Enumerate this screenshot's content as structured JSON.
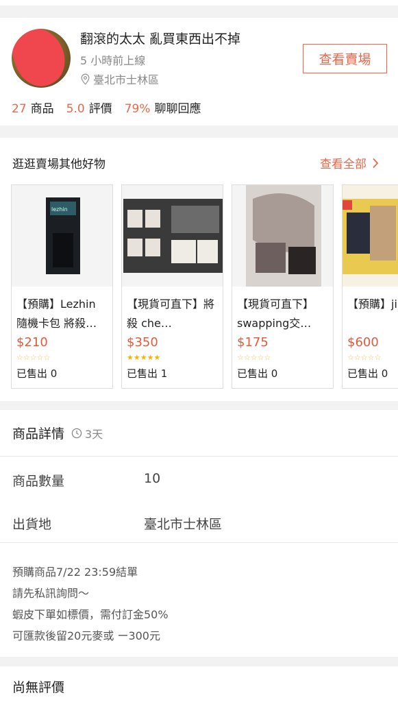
{
  "seller": {
    "name": "翻滾的太太 亂買東西出不掉",
    "status": "5 小時前上線",
    "location": "臺北市士林區",
    "view_shop": "查看賣場",
    "stats": [
      {
        "num": "27",
        "label": "商品"
      },
      {
        "num": "5.0",
        "label": "評價"
      },
      {
        "num": "79%",
        "label": "聊聊回應"
      }
    ]
  },
  "other_goods": {
    "title": "逛逛賣場其他好物",
    "view_all": "查看全部",
    "items": [
      {
        "title": "【預購】Lezhin 隨機卡包 將殺…",
        "price": "$210",
        "rating": 0,
        "sold": "已售出 0"
      },
      {
        "title": "【現貨可直下】將殺 che…",
        "price": "$350",
        "rating": 5,
        "sold": "已售出 1"
      },
      {
        "title": "【現貨可直下】swapping交…",
        "price": "$175",
        "rating": 0,
        "sold": "已售出 0"
      },
      {
        "title": "【預購】jinx 日版",
        "price": "$600",
        "rating": 0,
        "sold": "已售出 0"
      }
    ]
  },
  "details": {
    "heading": "商品詳情",
    "time": "3天",
    "quantity_label": "商品數量",
    "quantity_value": "10",
    "ship_label": "出貨地",
    "ship_value": "臺北市士林區",
    "description": [
      "預購商品7/22 23:59結單",
      "請先私訊詢問～",
      "蝦皮下單如標價，需付訂金50%",
      "可匯款後留20元麥或 ー300元"
    ]
  },
  "reviews": {
    "title": "尚無評價"
  },
  "colors": {
    "accent": "#e8674a",
    "price": "#e05a3d",
    "star": "#f2b600"
  }
}
